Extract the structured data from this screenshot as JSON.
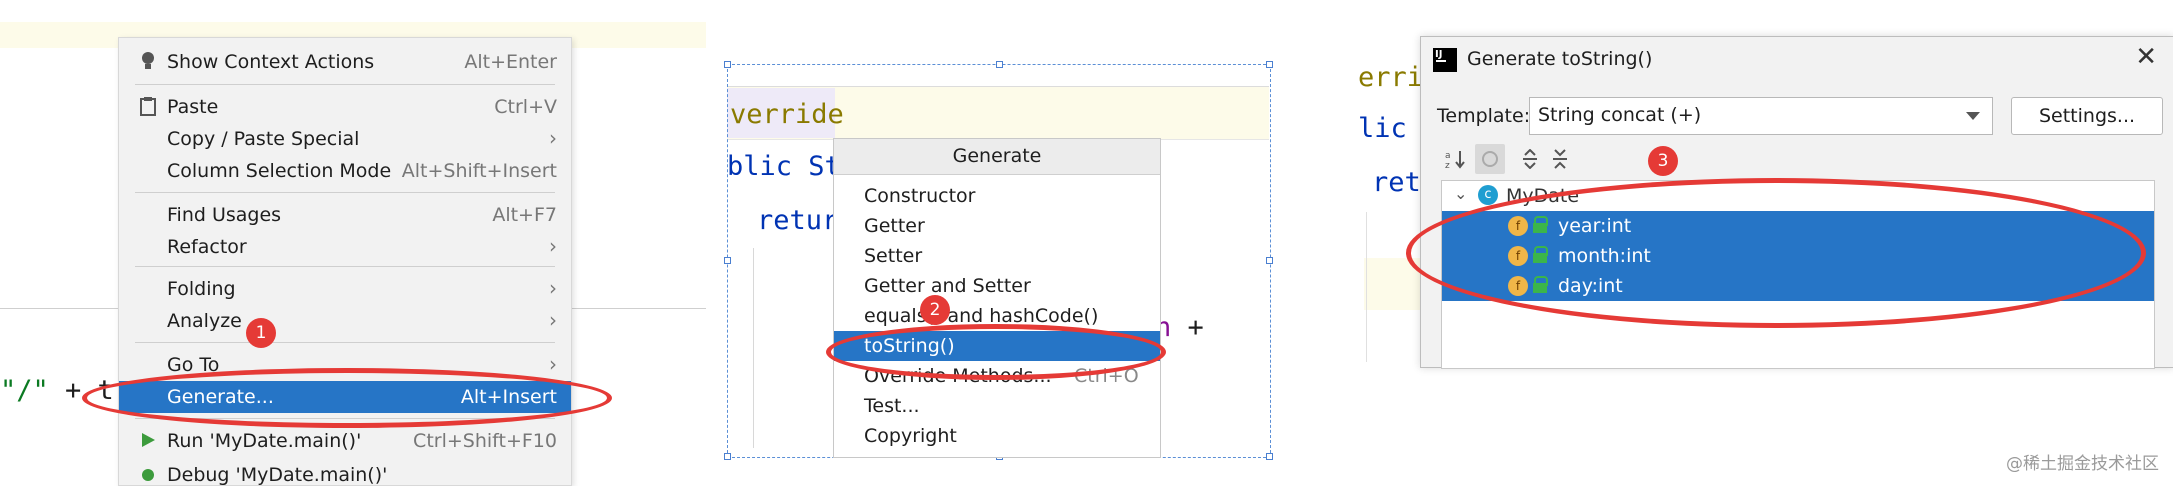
{
  "panel1": {
    "code_fragment": "\"/\" + t",
    "menu": [
      {
        "label": "Show Context Actions",
        "shortcut": "Alt+Enter",
        "icon": "lightbulb-icon"
      },
      {
        "label": "Paste",
        "shortcut": "Ctrl+V",
        "icon": "clipboard-icon"
      },
      {
        "label": "Copy / Paste Special",
        "submenu": true
      },
      {
        "label": "Column Selection Mode",
        "shortcut": "Alt+Shift+Insert"
      },
      {
        "label": "Find Usages",
        "shortcut": "Alt+F7"
      },
      {
        "label": "Refactor",
        "submenu": true
      },
      {
        "label": "Folding",
        "submenu": true
      },
      {
        "label": "Analyze",
        "submenu": true
      },
      {
        "label": "Go To",
        "submenu": true
      },
      {
        "label": "Generate...",
        "shortcut": "Alt+Insert",
        "selected": true
      },
      {
        "label": "Run 'MyDate.main()'",
        "shortcut": "Ctrl+Shift+F10",
        "icon": "run-icon"
      },
      {
        "label": "Debug 'MyDate.main()'",
        "icon": "debug-icon"
      }
    ],
    "badge": "1"
  },
  "panel2": {
    "code_override": "verride",
    "code_public": "blic St",
    "code_return": "retur",
    "code_tail": "n +",
    "popup_title": "Generate",
    "items": [
      {
        "label": "Constructor"
      },
      {
        "label": "Getter"
      },
      {
        "label": "Setter"
      },
      {
        "label": "Getter and Setter"
      },
      {
        "label": "equals() and hashCode()"
      },
      {
        "label": "toString()",
        "selected": true
      },
      {
        "label": "Override Methods...",
        "shortcut": "Ctrl+O"
      },
      {
        "label": "Test..."
      },
      {
        "label": "Copyright"
      }
    ],
    "badge": "2"
  },
  "panel3": {
    "code_erri": "erri",
    "code_lic": "lic :",
    "code_ret": "retu",
    "dialog_title": "Generate toString()",
    "template_label": "Template:",
    "template_value": "String concat (+)",
    "settings_label": "Settings...",
    "tree": {
      "root": "MyDate",
      "fields": [
        "year:int",
        "month:int",
        "day:int"
      ]
    },
    "badge": "3"
  },
  "watermark": "@稀土掘金技术社区",
  "colors": {
    "selection": "#2675c6",
    "annotation_red": "#e53a36",
    "menu_bg": "#f2f2f2"
  }
}
